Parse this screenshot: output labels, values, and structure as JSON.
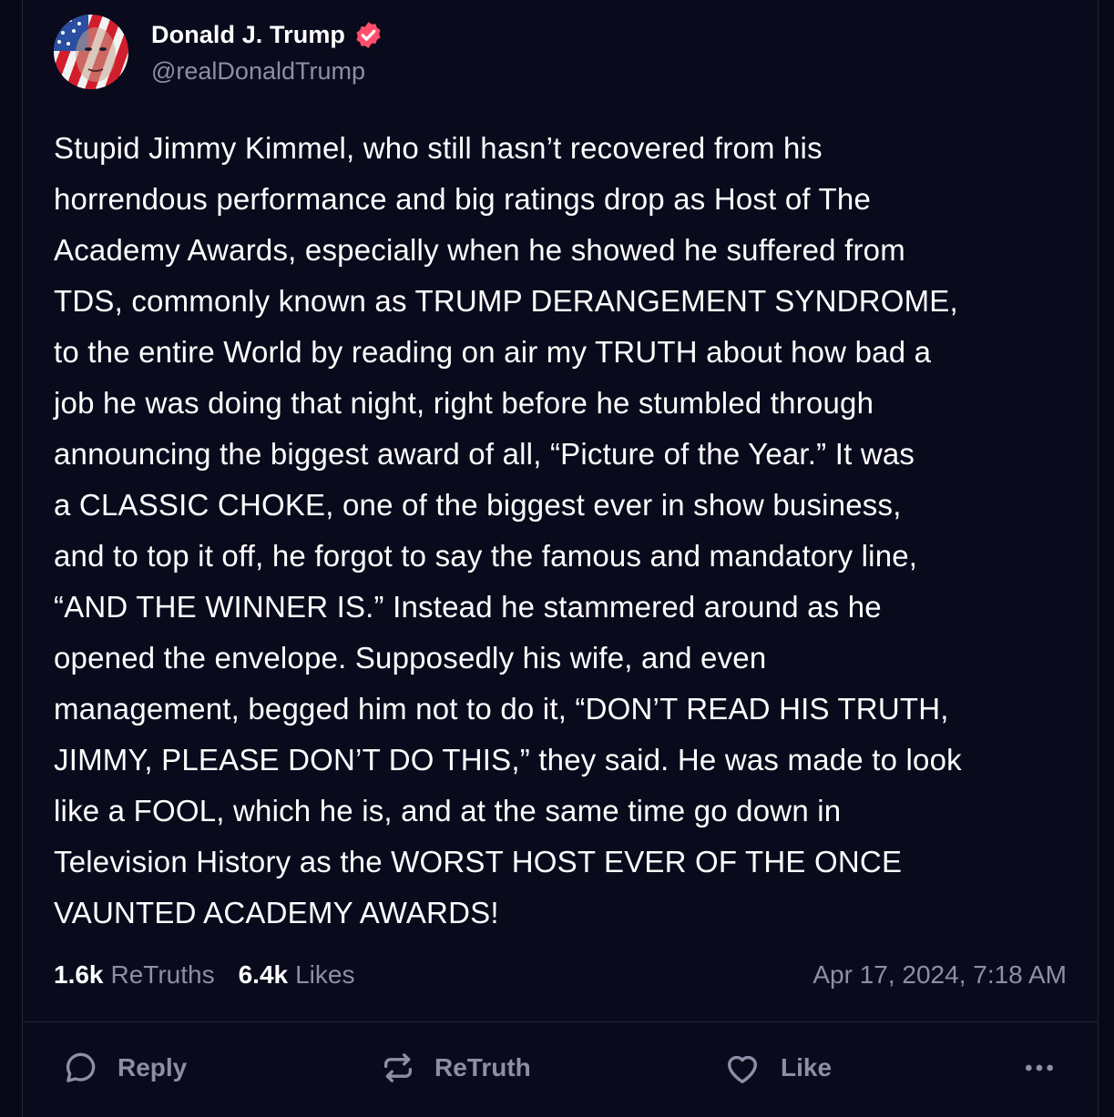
{
  "author": {
    "display_name": "Donald J. Trump",
    "handle": "@realDonaldTrump",
    "verified_badge_icon": "verified-badge-icon",
    "badge_color": "#ff4f6d"
  },
  "post": {
    "lines": [
      "Stupid Jimmy Kimmel, who still hasn’t recovered from his",
      "horrendous performance and big ratings drop as Host of The",
      "Academy Awards, especially when he showed he suffered from",
      "TDS, commonly known as TRUMP DERANGEMENT SYNDROME,",
      "to the entire World by reading on air my TRUTH about how bad a",
      "job he was doing that night, right before he stumbled through",
      "announcing the biggest award of all, “Picture of the Year.” It was",
      "a CLASSIC CHOKE, one of the biggest ever in show business,",
      "and to top it off, he forgot to say the famous and mandatory line,",
      "“AND THE WINNER IS.” Instead he stammered around as he",
      "opened the envelope. Supposedly his wife, and even",
      "management, begged him not to do it, “DON’T READ HIS TRUTH,",
      "JIMMY, PLEASE DON’T DO THIS,” they said. He was made to look",
      "like a FOOL, which he is, and at the same time go down in",
      "Television History as the WORST HOST EVER OF THE ONCE",
      "VAUNTED ACADEMY AWARDS!"
    ]
  },
  "stats": {
    "retruths_count": "1.6k",
    "retruths_label": "ReTruths",
    "likes_count": "6.4k",
    "likes_label": "Likes"
  },
  "timestamp": "Apr 17, 2024, 7:18 AM",
  "actions": {
    "reply_label": "Reply",
    "retruth_label": "ReTruth",
    "like_label": "Like",
    "reply_icon": "chat-bubble-icon",
    "retruth_icon": "repost-arrows-icon",
    "like_icon": "heart-icon",
    "more_icon": "more-dots-icon"
  },
  "colors": {
    "background": "#090a1c",
    "text": "#ffffff",
    "muted": "#8c8fa6",
    "border": "#25253a"
  }
}
